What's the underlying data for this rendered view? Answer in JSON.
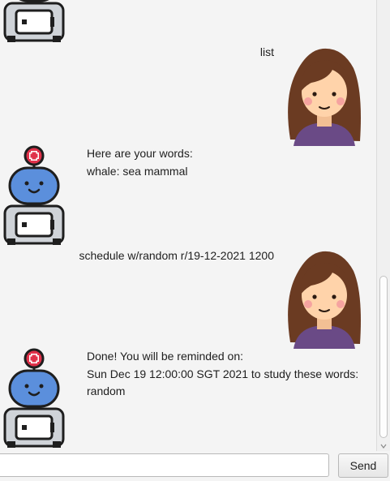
{
  "messages": [
    {
      "sender": "user",
      "text": "list"
    },
    {
      "sender": "bot",
      "text": "Here are your words:\nwhale: sea mammal"
    },
    {
      "sender": "user",
      "text": "schedule w/random r/19-12-2021 1200"
    },
    {
      "sender": "bot",
      "text": "Done! You will be reminded on:\nSun Dec 19 12:00:00 SGT 2021 to study these words:\nrandom"
    }
  ],
  "input": {
    "value": "",
    "placeholder": ""
  },
  "send_label": "Send",
  "icons": {
    "bot": "robot-avatar-icon",
    "user": "girl-avatar-icon"
  },
  "colors": {
    "background": "#f4f4f4",
    "robot_head": "#5b8fdc",
    "robot_badge": "#e0314a",
    "hair": "#6b3b22",
    "shirt": "#6a4a86",
    "skin": "#ffd3aa"
  }
}
